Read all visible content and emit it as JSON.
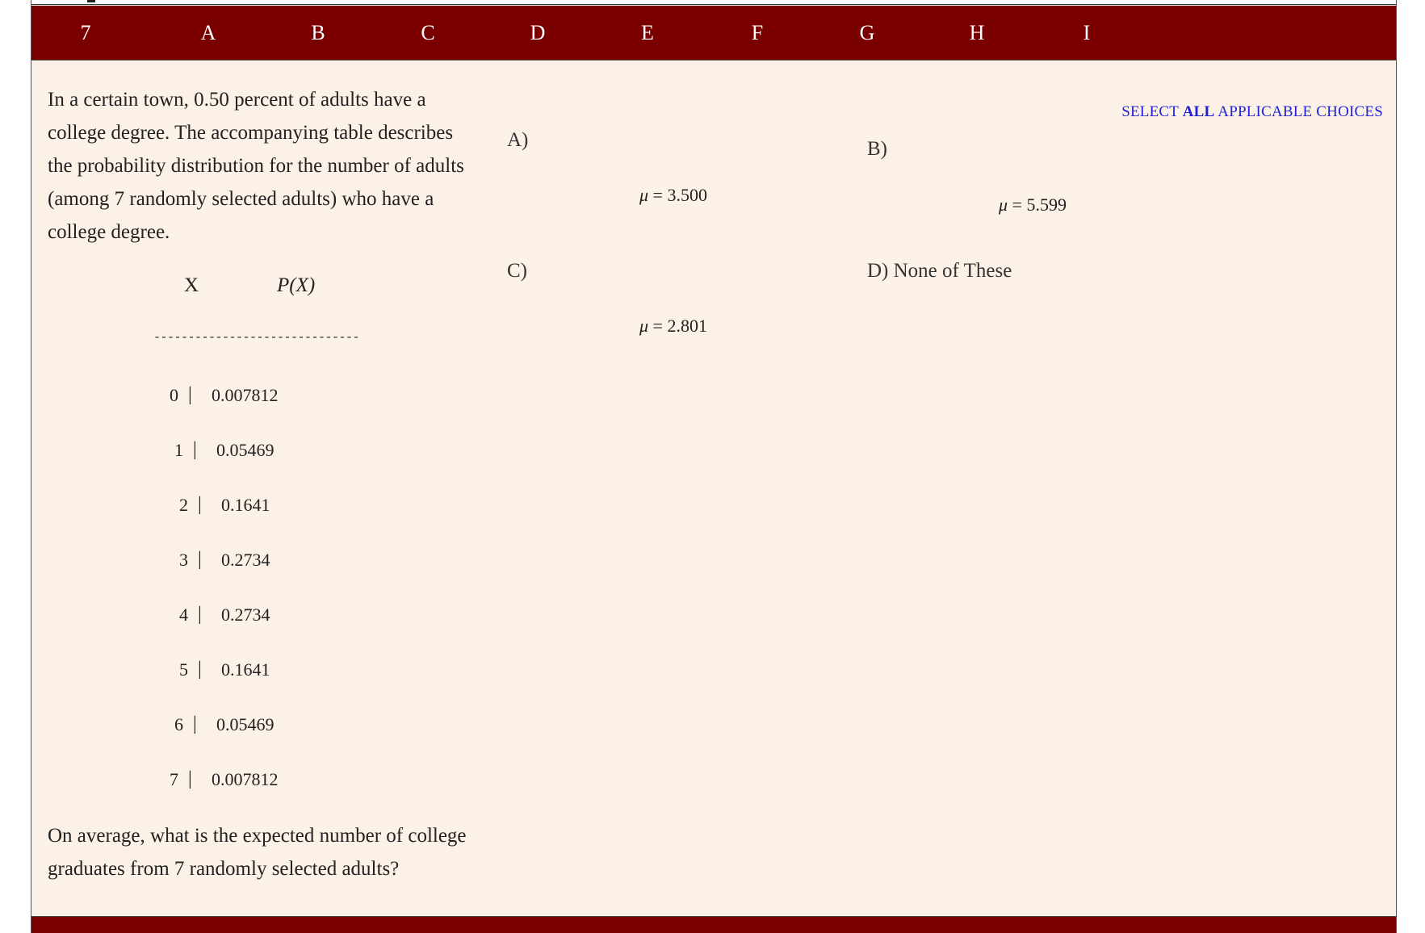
{
  "header": {
    "question_number": "7",
    "columns": [
      "A",
      "B",
      "C",
      "D",
      "E",
      "F",
      "G",
      "H",
      "I"
    ]
  },
  "question": {
    "text": "In a certain town, 0.50 percent of adults have a college degree. The accompanying table describes the probability distribution for the number of adults (among 7 randomly selected adults) who have a college degree.",
    "closing": "On average, what is the expected number of college graduates from 7 randomly selected adults?"
  },
  "table": {
    "col_x": "X",
    "col_p": "P(X)",
    "divider": "------------------------------",
    "separator": "|",
    "rows": [
      {
        "x": "0",
        "p": "0.007812"
      },
      {
        "x": "1",
        "p": "0.05469"
      },
      {
        "x": "2",
        "p": "0.1641"
      },
      {
        "x": "3",
        "p": "0.2734"
      },
      {
        "x": "4",
        "p": "0.2734"
      },
      {
        "x": "5",
        "p": "0.1641"
      },
      {
        "x": "6",
        "p": "0.05469"
      },
      {
        "x": "7",
        "p": "0.007812"
      }
    ]
  },
  "instructions": {
    "prefix": "SELECT ",
    "bold": "ALL",
    "suffix": " APPLICABLE CHOICES"
  },
  "choices": {
    "a": {
      "label": "A)",
      "symbol": "μ",
      "equals": " = ",
      "value": "3.500"
    },
    "b": {
      "label": "B)",
      "symbol": "μ",
      "equals": " = ",
      "value": "5.599"
    },
    "c": {
      "label": "C)",
      "symbol": "μ",
      "equals": " = ",
      "value": "2.801"
    },
    "d": {
      "label": "D) None of These"
    }
  },
  "colors": {
    "header_bg": "#7a0000",
    "content_bg": "#fcf1e6",
    "instruction_text": "#2020d8"
  }
}
